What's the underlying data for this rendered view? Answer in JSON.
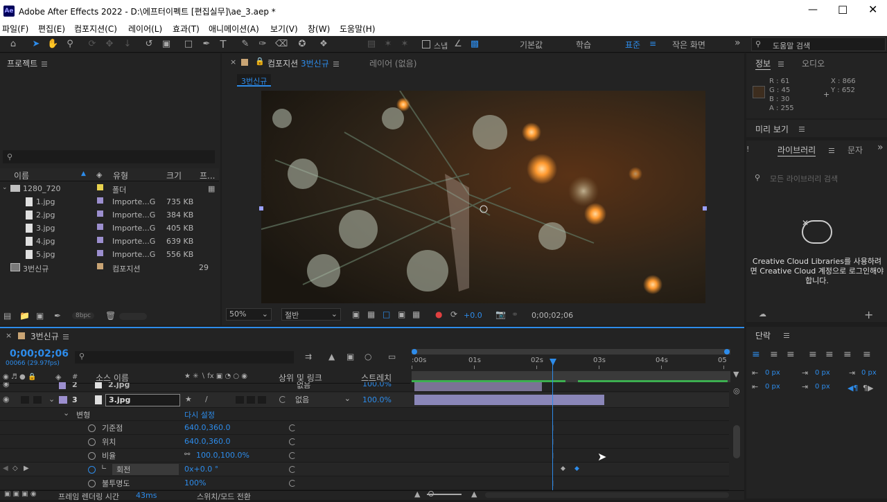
{
  "window": {
    "title": "Adobe After Effects 2022 - D:\\에프터이펙트 [편집실무]\\ae_3.aep *",
    "app_icon": "Ae"
  },
  "menu": [
    "파일(F)",
    "편집(E)",
    "컴포지션(C)",
    "레이어(L)",
    "효과(T)",
    "애니메이션(A)",
    "보기(V)",
    "창(W)",
    "도움말(H)"
  ],
  "toolbar": {
    "snap_label": "스냅",
    "workspaces": [
      "기본값",
      "학습",
      "표준",
      "작은 화면"
    ],
    "search_placeholder": "도움말 검색"
  },
  "project": {
    "title": "프로젝트",
    "search_placeholder": "",
    "columns": [
      "이름",
      "유형",
      "크기",
      "프..."
    ],
    "items": [
      {
        "name": "1280_720",
        "type": "폴더",
        "size": "",
        "color": "#e8d24e",
        "kind": "folder"
      },
      {
        "name": "1.jpg",
        "type": "Importe...G",
        "size": "735 KB",
        "color": "#9c8fcf",
        "kind": "file"
      },
      {
        "name": "2.jpg",
        "type": "Importe...G",
        "size": "384 KB",
        "color": "#9c8fcf",
        "kind": "file"
      },
      {
        "name": "3.jpg",
        "type": "Importe...G",
        "size": "405 KB",
        "color": "#9c8fcf",
        "kind": "file"
      },
      {
        "name": "4.jpg",
        "type": "Importe...G",
        "size": "639 KB",
        "color": "#9c8fcf",
        "kind": "file"
      },
      {
        "name": "5.jpg",
        "type": "Importe...G",
        "size": "556 KB",
        "color": "#9c8fcf",
        "kind": "file"
      },
      {
        "name": "3번신규",
        "type": "컴포지션",
        "size": "",
        "frame": "29",
        "color": "#c9a474",
        "kind": "comp"
      }
    ],
    "bpc": "8bpc"
  },
  "composition": {
    "tab_prefix": "컴포지션",
    "tab_name": "3번신규",
    "layer_tab": "레이어 (없음)",
    "breadcrumb": "3번신규",
    "zoom": "50%",
    "resolution": "절반",
    "exposure": "+0.0",
    "timecode": "0;00;02;06"
  },
  "info": {
    "tab": "정보",
    "audio_tab": "오디오",
    "r": "R : 61",
    "g": "G : 45",
    "b": "B : 30",
    "a": "A : 255",
    "x": "X : 866",
    "y": "Y : 652",
    "swatch": "#3d2d1e"
  },
  "preview": {
    "title": "미리 보기"
  },
  "libraries": {
    "tab": "라이브러리",
    "char_tab": "문자",
    "search_placeholder": "모든 라이브러리 검색",
    "message": "Creative Cloud Libraries를 사용하려면 Creative Cloud 계정으로 로그인해야 합니다."
  },
  "paragraph": {
    "title": "단락",
    "vals": [
      "0 px",
      "0 px",
      "0 px",
      "0 px",
      "0 px"
    ]
  },
  "timeline": {
    "comp_name": "3번신규",
    "timecode": "0;00;02;06",
    "frame_info": "00066 (29.97fps)",
    "ruler": [
      ":00s",
      "01s",
      "02s",
      "03s",
      "04s",
      "05"
    ],
    "col_source": "소스 이름",
    "col_parent": "상위 및 링크",
    "col_stretch": "스트레치",
    "layers": [
      {
        "num": "2",
        "name": "2.jpg",
        "parent": "없음",
        "stretch": "100.0%"
      },
      {
        "num": "3",
        "name": "3.jpg",
        "parent": "없음",
        "stretch": "100.0%"
      }
    ],
    "transform": {
      "label": "변형",
      "reset": "다시 설정"
    },
    "props": [
      {
        "name": "기준점",
        "value": "640.0,360.0"
      },
      {
        "name": "위치",
        "value": "640.0,360.0"
      },
      {
        "name": "비율",
        "value": "100.0,100.0%"
      },
      {
        "name": "회전",
        "value": "0x+0.0 °"
      },
      {
        "name": "불투명도",
        "value": "100%"
      }
    ],
    "footer_render": "프레임 렌더링 시간",
    "footer_ms": "43ms",
    "footer_switch": "스위치/모드 전환"
  }
}
